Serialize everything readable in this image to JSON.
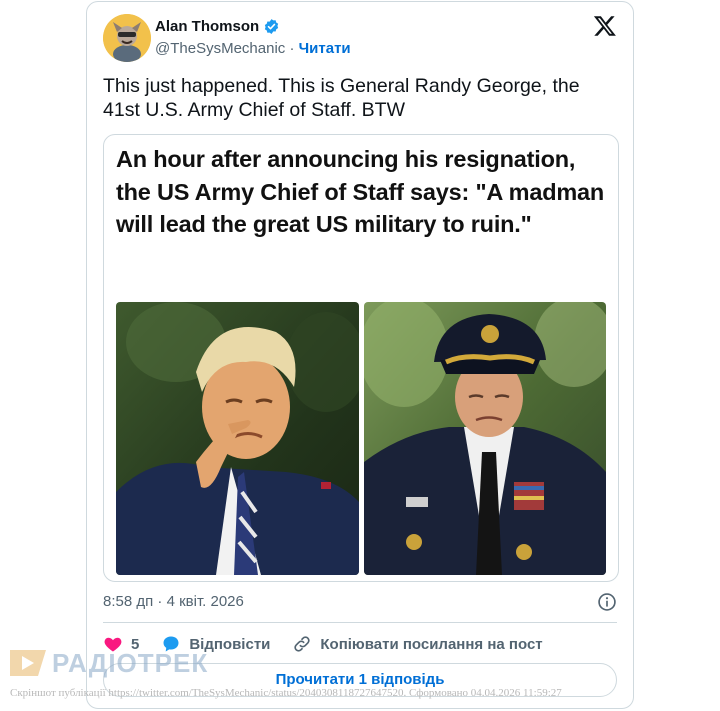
{
  "tweet": {
    "author_name": "Alan Thomson",
    "handle": "@TheSysMechanic",
    "separator": "·",
    "follow_label": "Читати",
    "text": "This just happened. This is General Randy George, the 41st U.S. Army Chief of Staff. BTW",
    "image_headline": "An hour after announcing his resignation, the US Army Chief of Staff says: \"A madman will lead the great US military to ruin.\"",
    "timestamp": "8:58 дп · 4 квіт. 2026",
    "likes_count": "5",
    "reply_label": "Відповісти",
    "copy_link_label": "Копіювати посилання на пост",
    "read_replies_label": "Прочитати 1 відповідь"
  },
  "watermark": {
    "logo_text": "РАДІОТРЕК"
  },
  "footer": {
    "text": "Скріншот публікації https://twitter.com/TheSysMechanic/status/2040308118727647520. Сформовано 04.04.2026 11:59:27"
  },
  "colors": {
    "link_blue": "#006fd6",
    "verified_blue": "#1d9bf0",
    "like_pink": "#f91880",
    "muted_gray": "#536471",
    "border": "#cfd9de"
  },
  "icons": [
    "avatar",
    "verified-badge-icon",
    "x-logo-icon",
    "info-icon",
    "heart-icon",
    "reply-bubble-icon",
    "link-icon"
  ]
}
